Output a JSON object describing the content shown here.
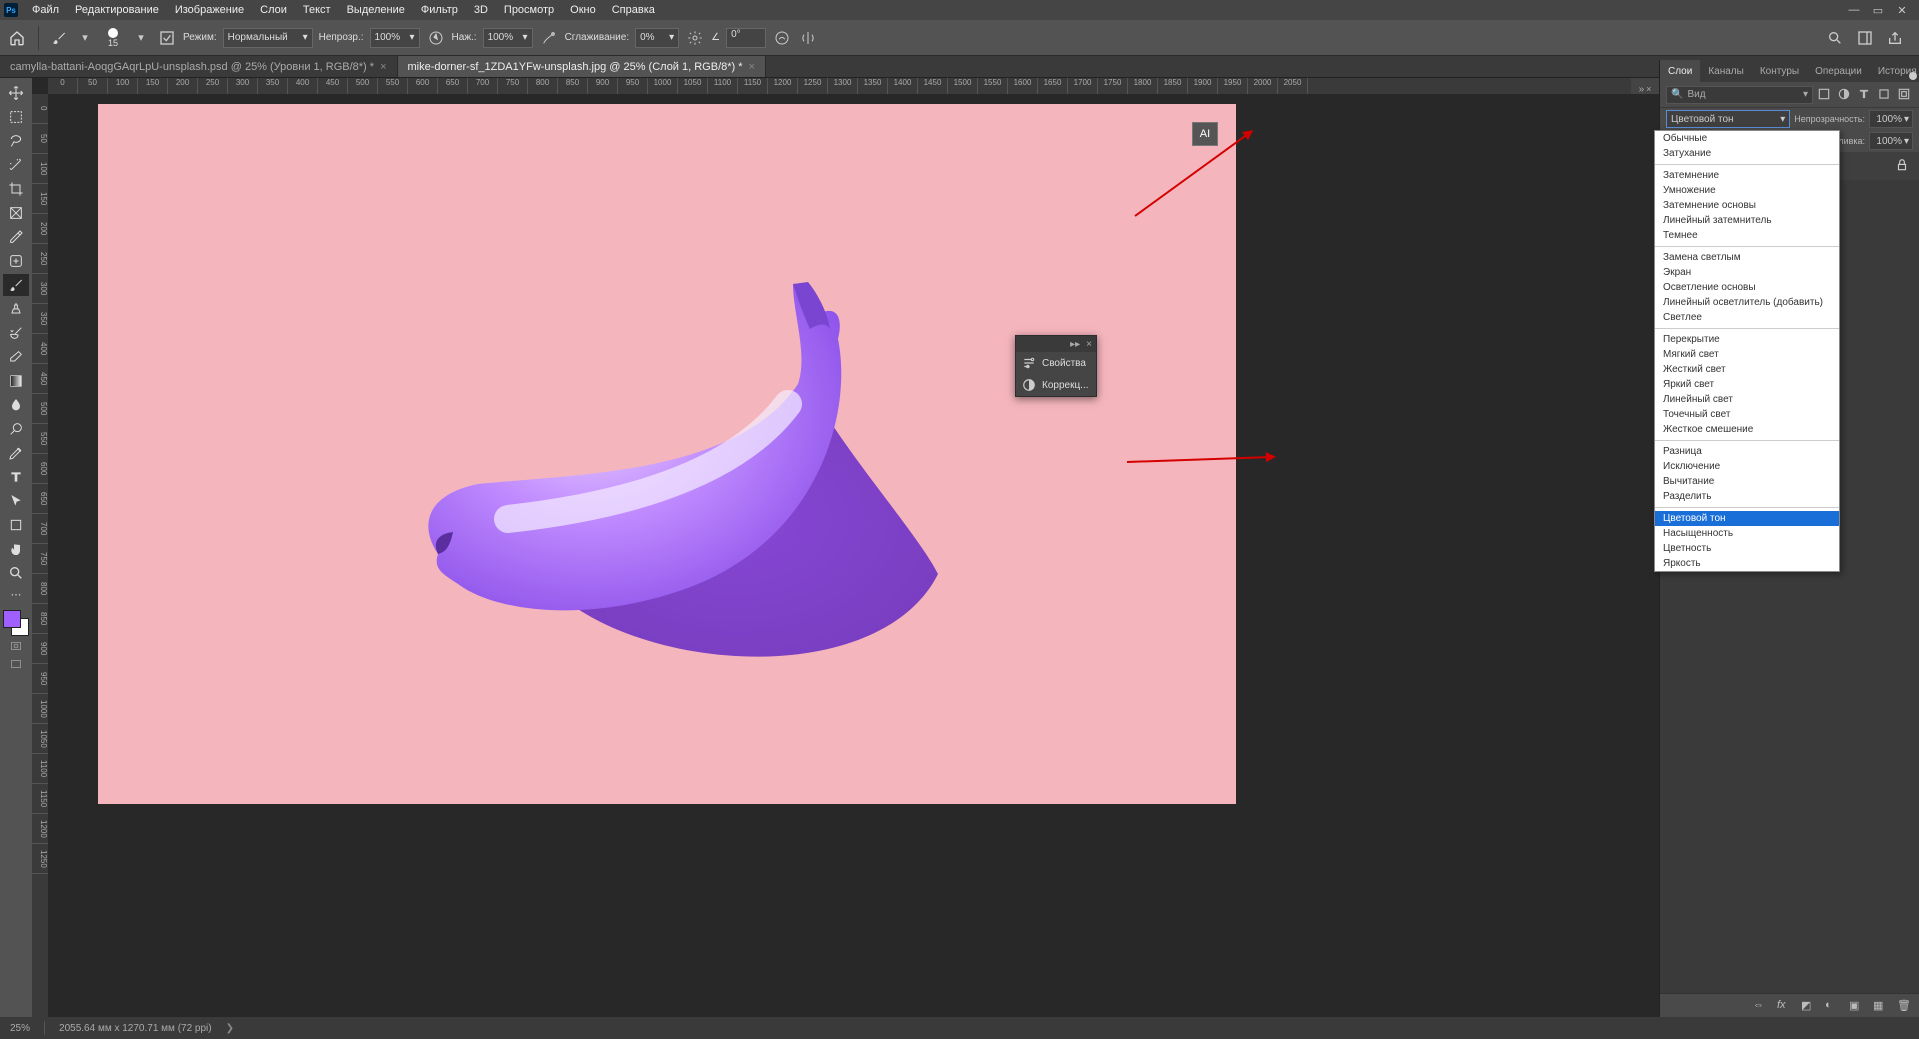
{
  "menu": {
    "items": [
      "Файл",
      "Редактирование",
      "Изображение",
      "Слои",
      "Текст",
      "Выделение",
      "Фильтр",
      "3D",
      "Просмотр",
      "Окно",
      "Справка"
    ]
  },
  "options": {
    "brush_size": "15",
    "mode_label": "Режим:",
    "mode_value": "Нормальный",
    "opacity_label": "Непрозр.:",
    "opacity_value": "100%",
    "flow_label": "Наж.:",
    "flow_value": "100%",
    "smoothing_label": "Сглаживание:",
    "smoothing_value": "0%",
    "angle_label": "∠",
    "angle_value": "0°"
  },
  "tabs": [
    {
      "title": "camylla-battani-AoqgGAqrLpU-unsplash.psd @ 25% (Уровни 1, RGB/8*) *"
    },
    {
      "title": "mike-dorner-sf_1ZDA1YFw-unsplash.jpg @ 25% (Слой 1, RGB/8*) *"
    }
  ],
  "ruler_h": [
    "0",
    "50",
    "100",
    "150",
    "200",
    "250",
    "300",
    "350",
    "400",
    "450",
    "500",
    "550",
    "600",
    "650",
    "700",
    "750",
    "800",
    "850",
    "900",
    "950",
    "1000",
    "1050",
    "1100",
    "1150",
    "1200",
    "1250",
    "1300",
    "1350",
    "1400",
    "1450",
    "1500",
    "1550",
    "1600",
    "1650",
    "1700",
    "1750",
    "1800",
    "1850",
    "1900",
    "1950",
    "2000",
    "2050"
  ],
  "ruler_v": [
    "0",
    "50",
    "100",
    "150",
    "200",
    "250",
    "300",
    "350",
    "400",
    "450",
    "500",
    "550",
    "600",
    "650",
    "700",
    "750",
    "800",
    "850",
    "900",
    "950",
    "1000",
    "1050",
    "1100",
    "1150",
    "1200",
    "1250"
  ],
  "ai_badge": "AI",
  "floating": {
    "properties": "Свойства",
    "adjustments": "Коррекц..."
  },
  "right": {
    "tabs": [
      "Слои",
      "Каналы",
      "Контуры",
      "Операции",
      "История"
    ],
    "search_placeholder": "Вид",
    "blend_current": "Цветовой тон",
    "opacity_label": "Непрозрачность:",
    "opacity_value": "100%",
    "fill_label": "Заливка:",
    "fill_value": "100%"
  },
  "blend_modes": {
    "g1": [
      "Обычные",
      "Затухание"
    ],
    "g2": [
      "Затемнение",
      "Умножение",
      "Затемнение основы",
      "Линейный затемнитель",
      "Темнее"
    ],
    "g3": [
      "Замена светлым",
      "Экран",
      "Осветление основы",
      "Линейный осветлитель (добавить)",
      "Светлее"
    ],
    "g4": [
      "Перекрытие",
      "Мягкий свет",
      "Жесткий свет",
      "Яркий свет",
      "Линейный свет",
      "Точечный свет",
      "Жесткое смешение"
    ],
    "g5": [
      "Разница",
      "Исключение",
      "Вычитание",
      "Разделить"
    ],
    "g6": [
      "Цветовой тон",
      "Насыщенность",
      "Цветность",
      "Яркость"
    ],
    "highlight": "Цветовой тон"
  },
  "status": {
    "zoom": "25%",
    "doc_info": "2055.64 мм x 1270.71 мм (72 ppi)"
  }
}
